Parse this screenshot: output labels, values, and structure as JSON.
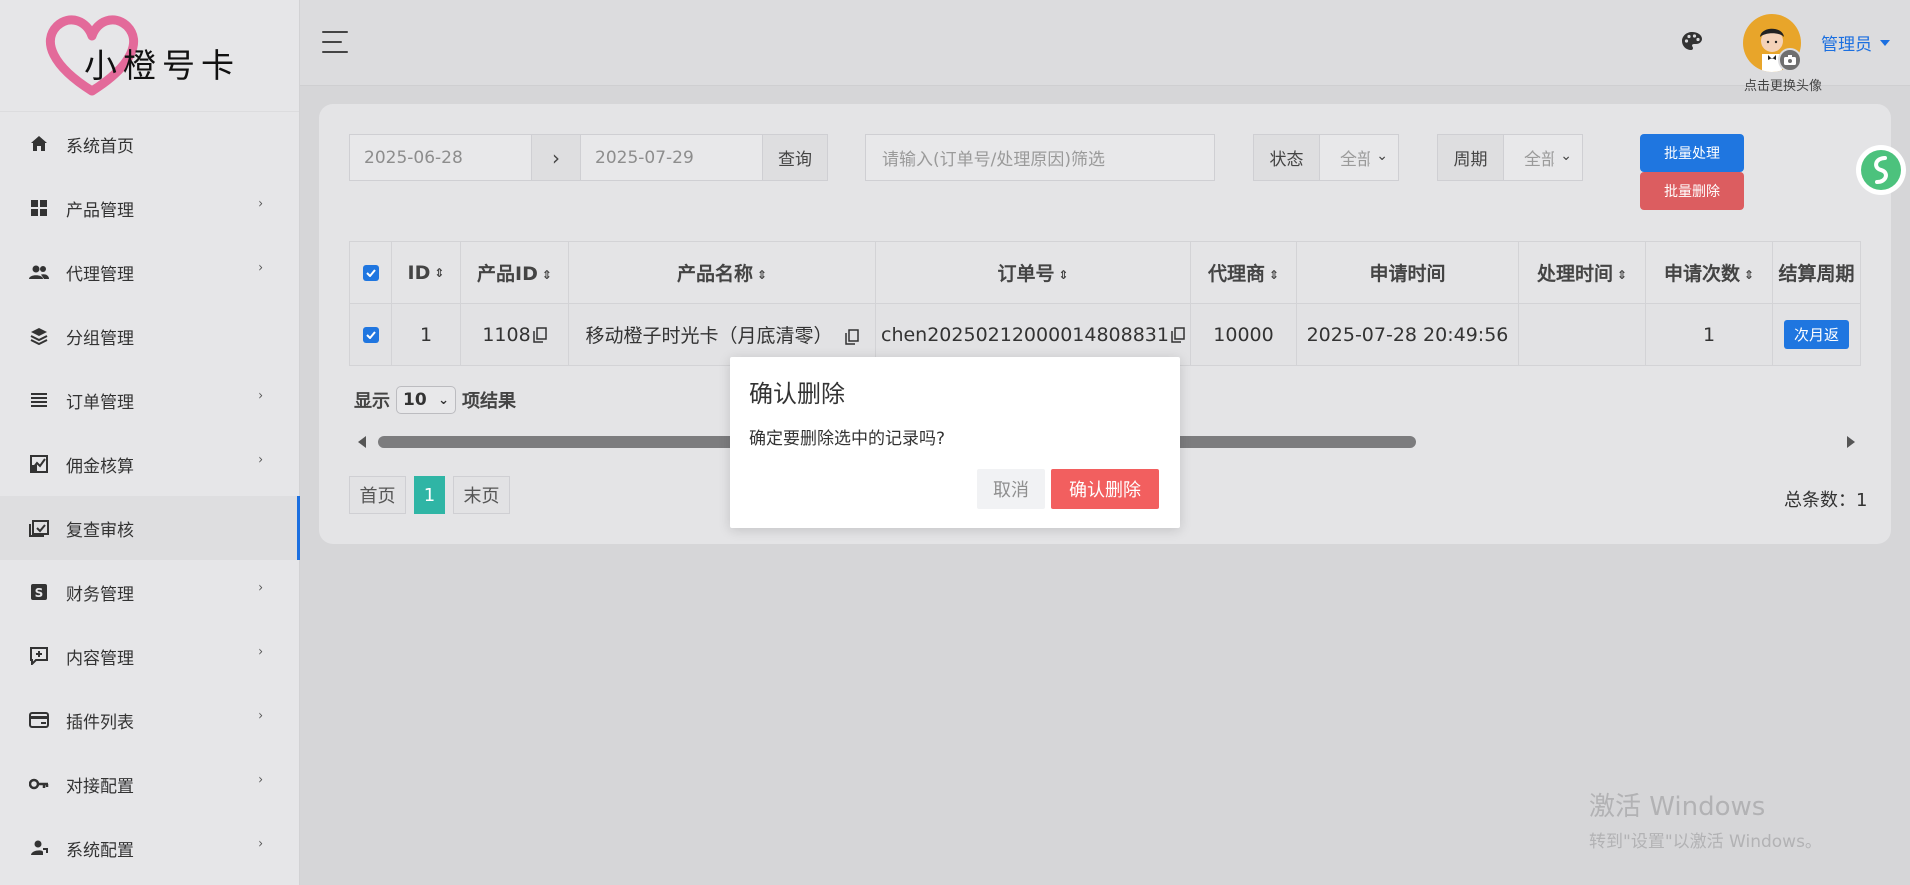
{
  "brand": {
    "logo_text": "小橙号卡"
  },
  "sidebar": {
    "items": [
      {
        "label": "系统首页",
        "icon": "home-icon",
        "has_children": false,
        "active": false
      },
      {
        "label": "产品管理",
        "icon": "grid-icon",
        "has_children": true,
        "active": false
      },
      {
        "label": "代理管理",
        "icon": "users-icon",
        "has_children": true,
        "active": false
      },
      {
        "label": "分组管理",
        "icon": "layers-icon",
        "has_children": false,
        "active": false
      },
      {
        "label": "订单管理",
        "icon": "list-icon",
        "has_children": true,
        "active": false
      },
      {
        "label": "佣金核算",
        "icon": "chart-box-icon",
        "has_children": true,
        "active": false
      },
      {
        "label": "复查审核",
        "icon": "calendar-check-icon",
        "has_children": false,
        "active": true
      },
      {
        "label": "财务管理",
        "icon": "finance-icon",
        "has_children": true,
        "active": false
      },
      {
        "label": "内容管理",
        "icon": "content-icon",
        "has_children": true,
        "active": false
      },
      {
        "label": "插件列表",
        "icon": "card-icon",
        "has_children": true,
        "active": false
      },
      {
        "label": "对接配置",
        "icon": "key-icon",
        "has_children": true,
        "active": false
      },
      {
        "label": "系统配置",
        "icon": "user-cog-icon",
        "has_children": true,
        "active": false
      }
    ]
  },
  "header": {
    "avatar_caption": "点击更换头像",
    "user_name": "管理员"
  },
  "filters": {
    "start_date": "2025-06-28",
    "range_arrow": "›",
    "end_date": "2025-07-29",
    "query_label": "查询",
    "search_placeholder": "请输入(订单号/处理原因)筛选",
    "status_label": "状态",
    "status_value": "全部",
    "period_label": "周期",
    "period_value": "全部",
    "batch_process_label": "批量处理",
    "batch_delete_label": "批量删除"
  },
  "table": {
    "columns": [
      "ID",
      "产品ID",
      "产品名称",
      "订单号",
      "代理商",
      "申请时间",
      "处理时间",
      "申请次数",
      "结算周期"
    ],
    "rows": [
      {
        "id": "1",
        "product_id": "1108",
        "product_name": "移动橙子时光卡（月底清零）",
        "order_no": "chen20250212000014808831",
        "agent": "10000",
        "apply_time": "2025-07-28 20:49:56",
        "process_time": "",
        "apply_count": "1",
        "cycle": "次月返"
      }
    ]
  },
  "pagination": {
    "show_label": "显示",
    "per_page": "10",
    "results_label": "项结果",
    "first": "首页",
    "current": "1",
    "last": "末页",
    "total": "总条数：1"
  },
  "modal": {
    "title": "确认删除",
    "message": "确定要删除选中的记录吗?",
    "cancel": "取消",
    "confirm": "确认删除"
  },
  "watermark": {
    "title": "激活 Windows",
    "subtitle": "转到\"设置\"以激活 Windows。"
  },
  "colors": {
    "primary": "#1f76e0",
    "danger": "#dc5d60",
    "confirm": "#f25f5f",
    "page_active": "#2fb5a5"
  }
}
